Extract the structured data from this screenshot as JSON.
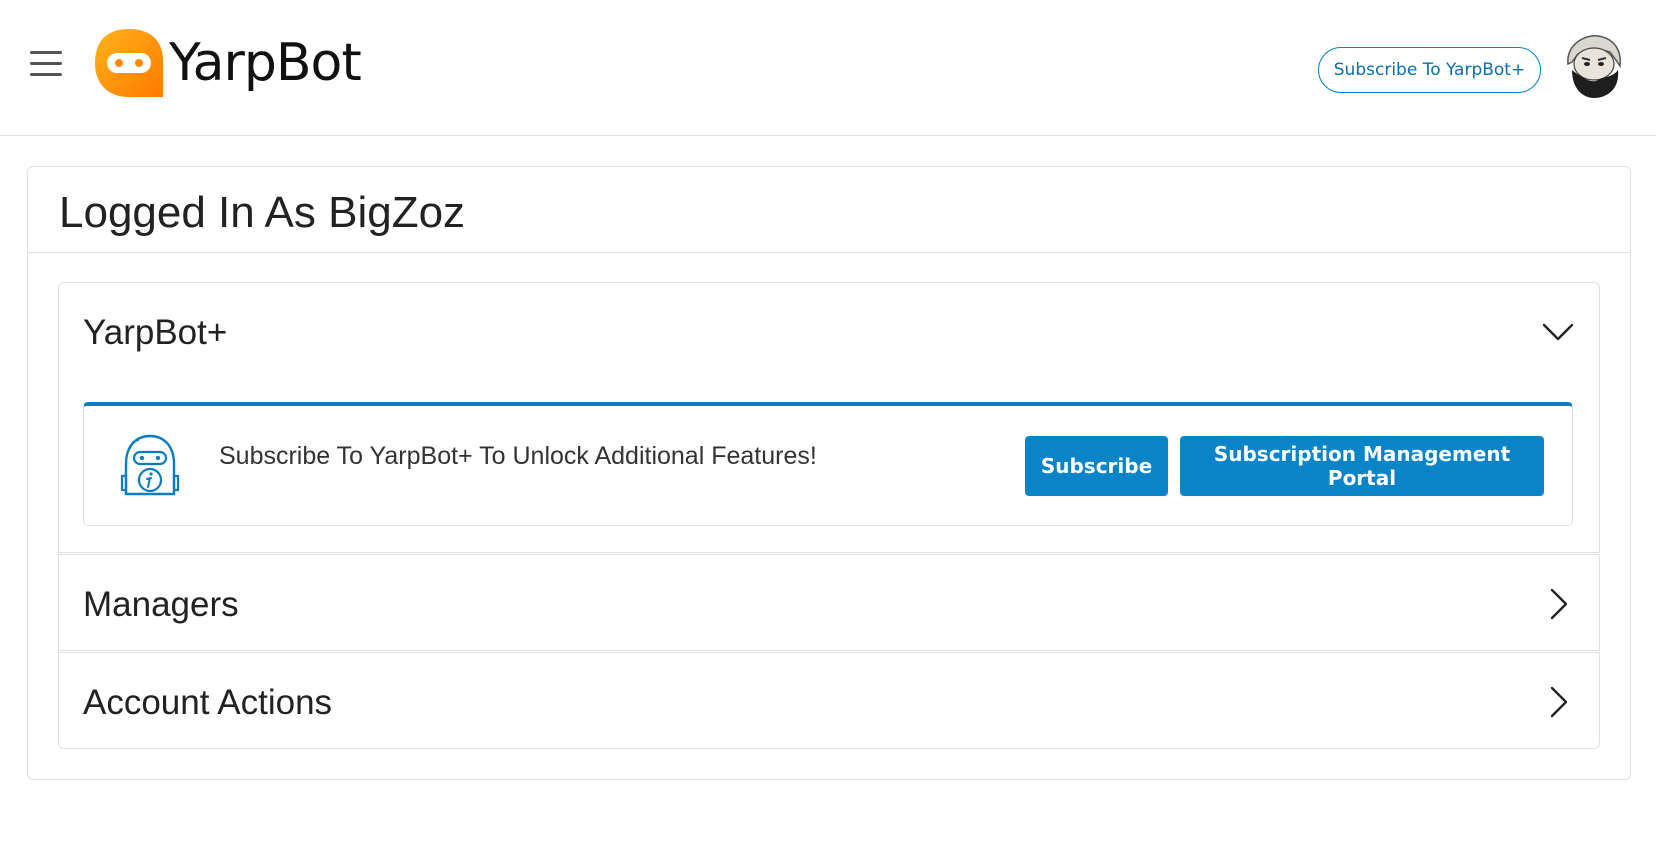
{
  "header": {
    "brand_name": "YarpBot",
    "subscribe_label": "Subscribe To YarpBot+"
  },
  "main": {
    "title": "Logged In As BigZoz",
    "sections": [
      {
        "label": "YarpBot+",
        "expanded": true,
        "info_text": "Subscribe To YarpBot+ To Unlock Additional Features!",
        "subscribe_button": "Subscribe",
        "portal_button": "Subscription Management Portal"
      },
      {
        "label": "Managers",
        "expanded": false
      },
      {
        "label": "Account Actions",
        "expanded": false
      }
    ]
  },
  "colors": {
    "accent": "#0a84c9",
    "brand_orange": "#ff9900",
    "border": "#e1e1e1"
  },
  "icons": [
    "hamburger-menu-icon",
    "yarpbot-logo-icon",
    "chevron-down-icon",
    "chevron-right-icon",
    "robot-info-icon"
  ]
}
